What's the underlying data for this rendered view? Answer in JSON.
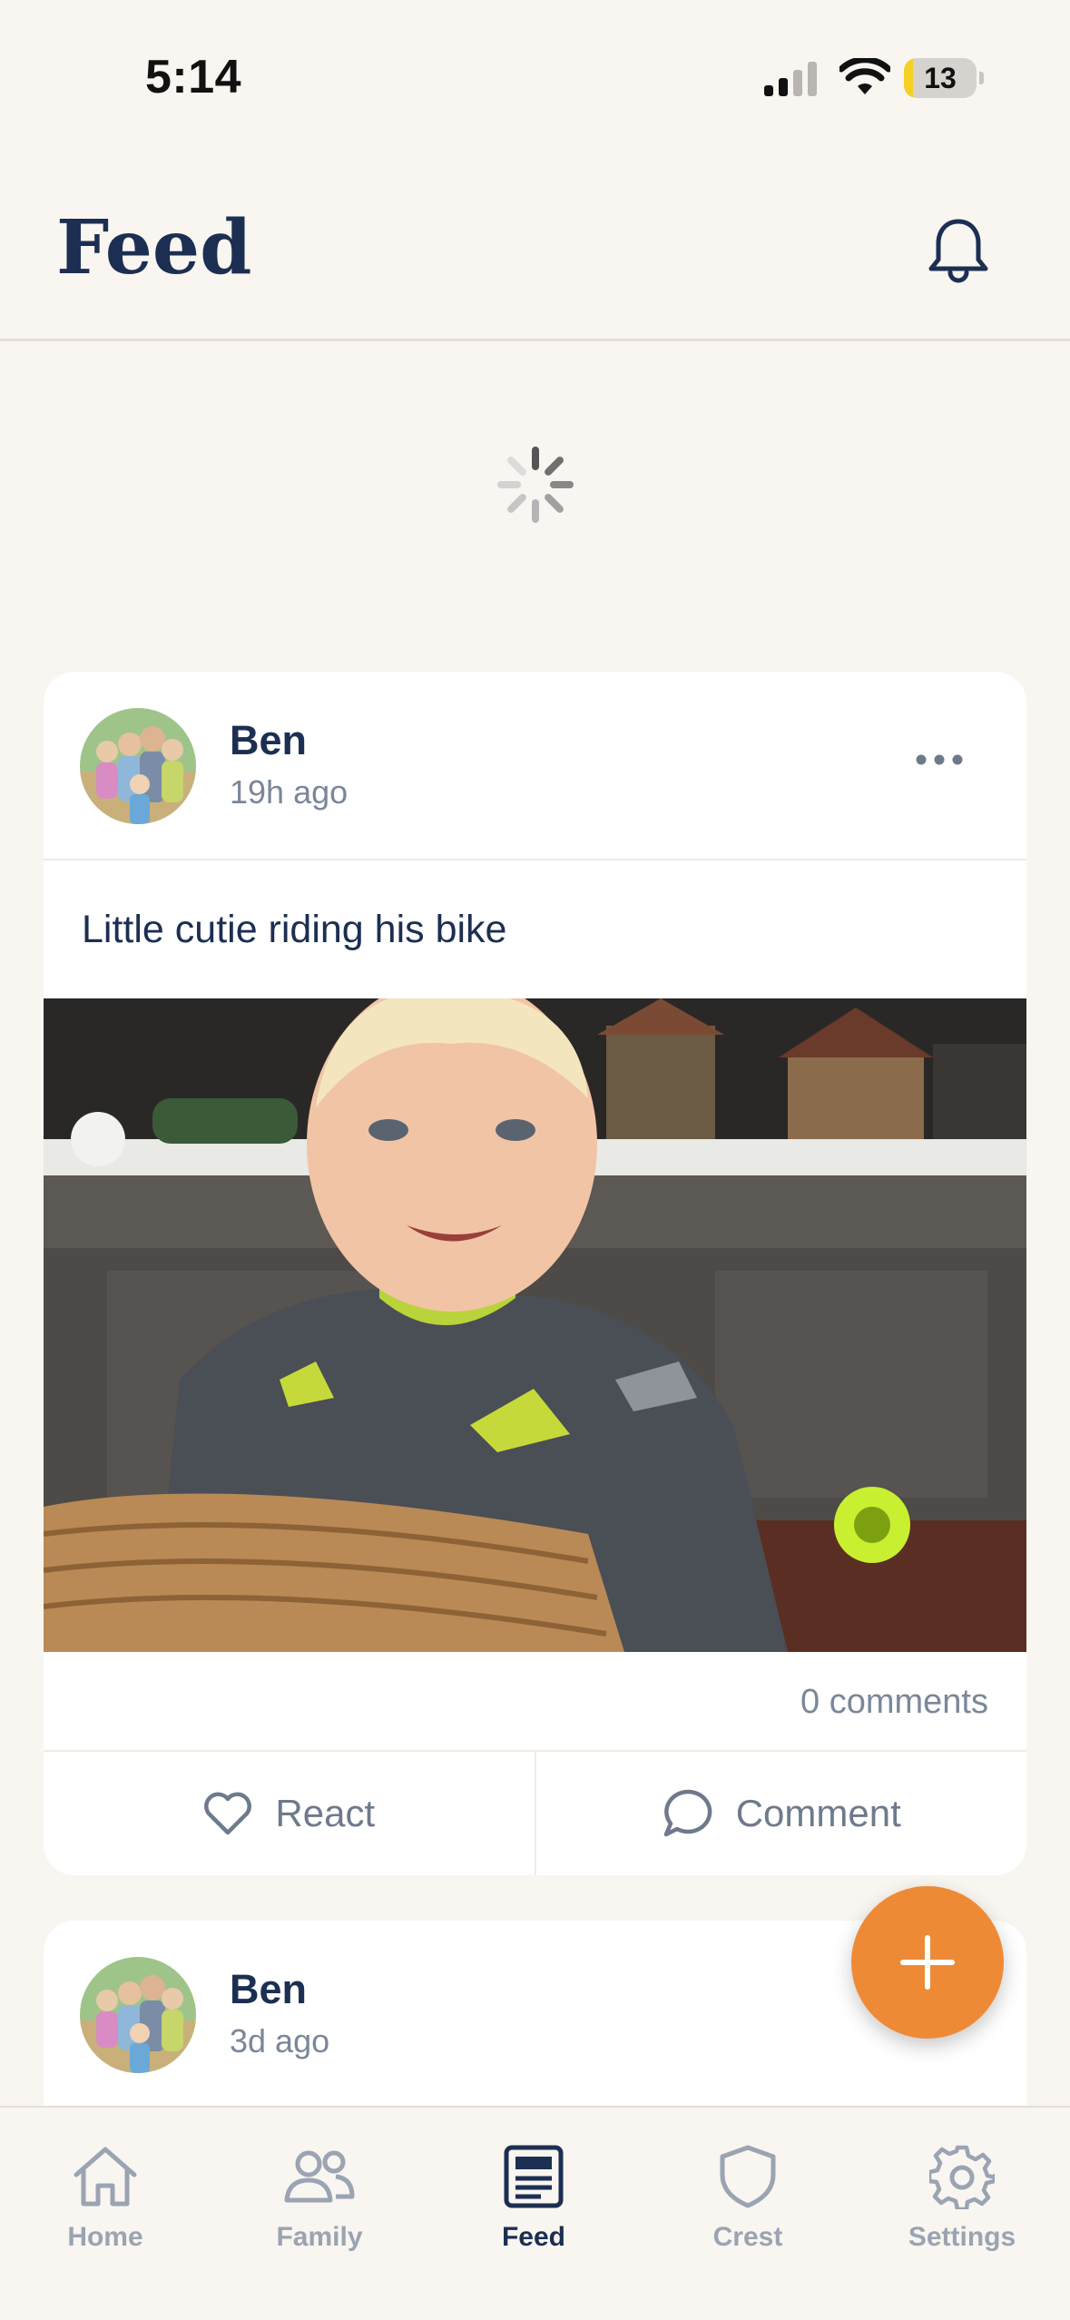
{
  "status_bar": {
    "time": "5:14",
    "battery": "13",
    "battery_level": 0.13
  },
  "header": {
    "title": "Feed"
  },
  "posts": [
    {
      "author": "Ben",
      "time_ago": "19h ago",
      "text": "Little cutie riding his bike",
      "comments": "0 comments",
      "react_label": "React",
      "comment_label": "Comment"
    },
    {
      "author": "Ben",
      "time_ago": "3d ago"
    }
  ],
  "tabs": [
    {
      "label": "Home",
      "icon": "home-icon"
    },
    {
      "label": "Family",
      "icon": "people-icon"
    },
    {
      "label": "Feed",
      "icon": "newspaper-icon",
      "active": true
    },
    {
      "label": "Crest",
      "icon": "shield-icon"
    },
    {
      "label": "Settings",
      "icon": "gear-icon"
    }
  ],
  "colors": {
    "background": "#f9f5f0",
    "navy": "#1c2f52",
    "muted": "#7b8799",
    "fab": "#ee8a36"
  }
}
